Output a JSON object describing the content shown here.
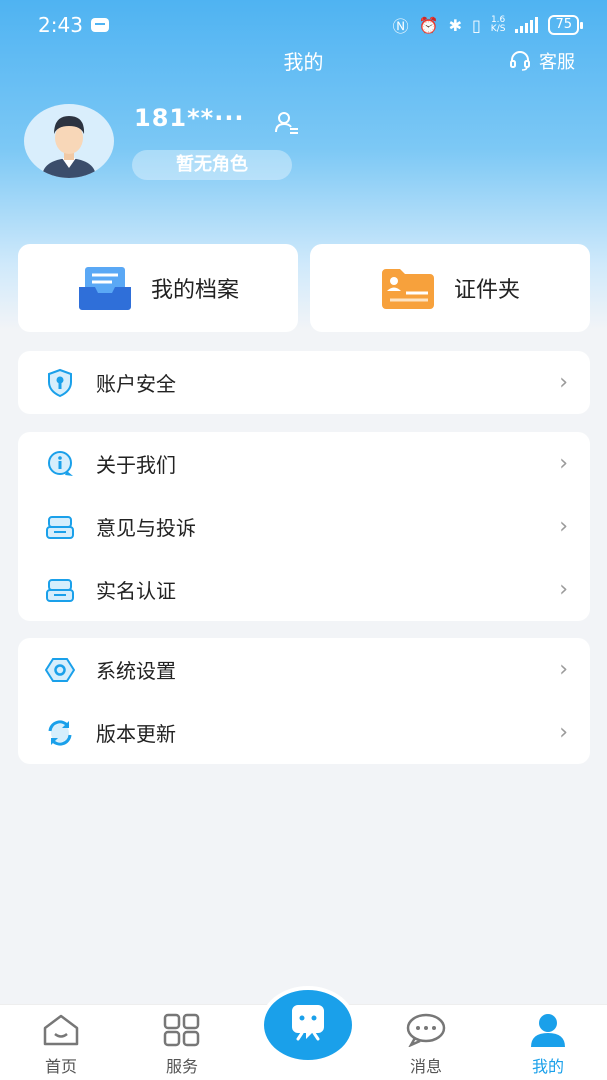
{
  "status_bar": {
    "time": "2:43",
    "net_speed_top": "1.6",
    "net_speed_bottom": "K/S",
    "battery": "75"
  },
  "header": {
    "title": "我的",
    "service_label": "客服"
  },
  "profile": {
    "phone": "181**···",
    "role": "暂无角色"
  },
  "quick_cards": [
    {
      "label": "我的档案",
      "icon": "archive-tray-icon"
    },
    {
      "label": "证件夹",
      "icon": "id-card-folder-icon"
    }
  ],
  "menu_groups": [
    [
      {
        "label": "账户安全",
        "icon": "shield-key-icon"
      }
    ],
    [
      {
        "label": "关于我们",
        "icon": "info-bubble-icon"
      },
      {
        "label": "意见与投诉",
        "icon": "feedback-box-icon"
      },
      {
        "label": "实名认证",
        "icon": "id-verify-icon"
      }
    ],
    [
      {
        "label": "系统设置",
        "icon": "settings-hex-icon"
      },
      {
        "label": "版本更新",
        "icon": "refresh-icon"
      }
    ]
  ],
  "tabbar": {
    "items": [
      {
        "label": "首页",
        "icon": "home-icon"
      },
      {
        "label": "服务",
        "icon": "grid-icon"
      },
      {
        "label": "消息",
        "icon": "chat-bubble-icon"
      },
      {
        "label": "我的",
        "icon": "user-icon"
      }
    ],
    "active": "我的"
  },
  "colors": {
    "accent": "#1aa0ea",
    "header_gradient_top": "#4fb3f2",
    "page_bg": "#f2f4f7"
  }
}
